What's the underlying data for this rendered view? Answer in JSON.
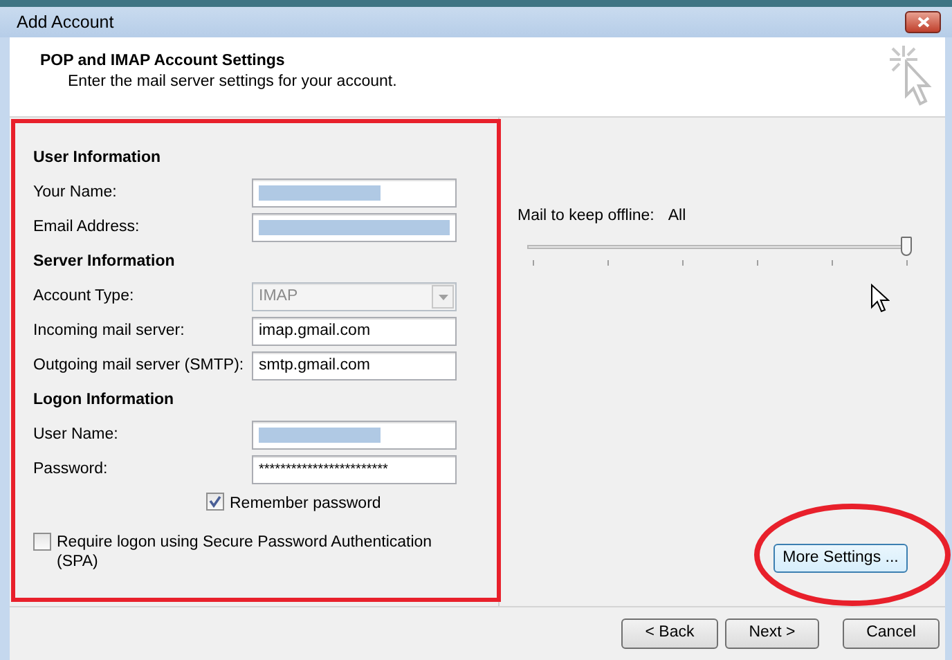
{
  "window": {
    "title": "Add Account"
  },
  "header": {
    "title": "POP and IMAP Account Settings",
    "subtitle": "Enter the mail server settings for your account."
  },
  "sections": [
    {
      "heading": "User Information",
      "fields": [
        {
          "label": "Your Name:",
          "kind": "text",
          "redacted": true
        },
        {
          "label": "Email Address:",
          "kind": "email",
          "redacted": true
        }
      ]
    },
    {
      "heading": "Server Information",
      "fields": [
        {
          "label": "Account Type:",
          "kind": "select",
          "value": "IMAP",
          "disabled": true
        },
        {
          "label": "Incoming mail server:",
          "kind": "text",
          "value": "imap.gmail.com"
        },
        {
          "label": "Outgoing mail server (SMTP):",
          "kind": "text",
          "value": "smtp.gmail.com"
        }
      ]
    },
    {
      "heading": "Logon Information",
      "fields": [
        {
          "label": "User Name:",
          "kind": "text",
          "redacted": true
        },
        {
          "label": "Password:",
          "kind": "password",
          "value": "************************"
        }
      ]
    }
  ],
  "remember_password": {
    "label": "Remember password",
    "checked": true
  },
  "require_spa": {
    "label": "Require logon using Secure Password Authentication (SPA)",
    "checked": false
  },
  "offline": {
    "label": "Mail to keep offline:",
    "value": "All",
    "level": 1
  },
  "more_settings": {
    "label": "More Settings ..."
  },
  "buttons": [
    {
      "label": "< Back"
    },
    {
      "label": "Next >"
    },
    {
      "label": "Cancel"
    }
  ],
  "annotations": {
    "frame_around_account_fields": true,
    "circle_around_more_settings": true
  }
}
